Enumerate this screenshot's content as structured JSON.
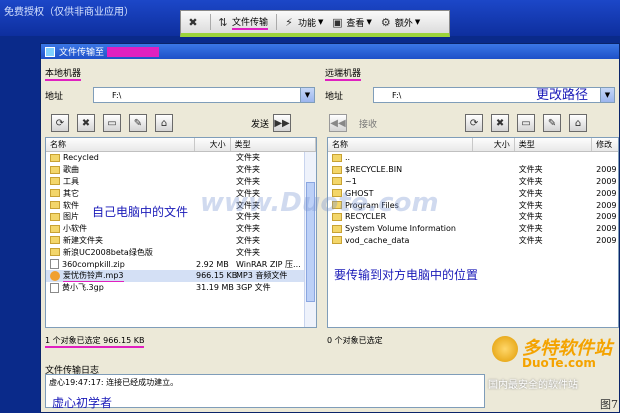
{
  "topbar": {
    "title": "免费授权（仅供非商业应用）"
  },
  "toolbar": {
    "items": [
      {
        "label": ""
      },
      {
        "label": "文件传输"
      },
      {
        "label": "功能"
      },
      {
        "label": "查看"
      },
      {
        "label": "额外"
      }
    ]
  },
  "window": {
    "title": "文件传输至",
    "local": {
      "label": "本地机器",
      "address_label": "地址",
      "address_value": "F:\\",
      "send_label": "发送",
      "columns": [
        "名称",
        "大小",
        "类型"
      ],
      "rows": [
        {
          "name": "Recycled",
          "size": "",
          "type": "文件夹",
          "kind": "folder"
        },
        {
          "name": "歌曲",
          "size": "",
          "type": "文件夹",
          "kind": "folder"
        },
        {
          "name": "工具",
          "size": "",
          "type": "文件夹",
          "kind": "folder"
        },
        {
          "name": "其它",
          "size": "",
          "type": "文件夹",
          "kind": "folder"
        },
        {
          "name": "软件",
          "size": "",
          "type": "文件夹",
          "kind": "folder"
        },
        {
          "name": "图片",
          "size": "",
          "type": "文件夹",
          "kind": "folder"
        },
        {
          "name": "小软件",
          "size": "",
          "type": "文件夹",
          "kind": "folder"
        },
        {
          "name": "新建文件夹",
          "size": "",
          "type": "文件夹",
          "kind": "folder"
        },
        {
          "name": "新浪UC2008beta绿色版",
          "size": "",
          "type": "文件夹",
          "kind": "folder"
        },
        {
          "name": "360compkill.zip",
          "size": "2.92 MB",
          "type": "WinRAR ZIP 压...",
          "kind": "file"
        },
        {
          "name": "爱忧伤铃声.mp3",
          "size": "966.15 KB",
          "type": "MP3 音频文件",
          "kind": "mp3",
          "selected": true
        },
        {
          "name": "黄小飞.3gp",
          "size": "31.19 MB",
          "type": "3GP 文件",
          "kind": "file"
        }
      ],
      "status": "1 个对象已选定    966.15 KB"
    },
    "remote": {
      "label": "远端机器",
      "address_label": "地址",
      "address_value": "F:\\",
      "receive_label": "接收",
      "columns": [
        "名称",
        "大小",
        "类型",
        "修改"
      ],
      "rows": [
        {
          "name": "..",
          "size": "",
          "type": "",
          "date": ""
        },
        {
          "name": "$RECYCLE.BIN",
          "size": "",
          "type": "文件夹",
          "date": "2009"
        },
        {
          "name": "~1",
          "size": "",
          "type": "文件夹",
          "date": "2009"
        },
        {
          "name": "GHOST",
          "size": "",
          "type": "文件夹",
          "date": "2009"
        },
        {
          "name": "Program Files",
          "size": "",
          "type": "文件夹",
          "date": "2009"
        },
        {
          "name": "RECYCLER",
          "size": "",
          "type": "文件夹",
          "date": "2009"
        },
        {
          "name": "System Volume Information",
          "size": "",
          "type": "文件夹",
          "date": "2009"
        },
        {
          "name": "vod_cache_data",
          "size": "",
          "type": "文件夹",
          "date": "2009"
        }
      ],
      "status": "0 个对象已选定"
    },
    "log": {
      "title": "文件传输日志",
      "entries": [
        "虚心19:47:17:  连接已经成功建立。"
      ]
    }
  },
  "annotations": {
    "local_files": "自己电脑中的文件",
    "change_path": "更改路径",
    "target_location": "要传输到对方电脑中的位置",
    "author": "虚心初学者"
  },
  "watermark": {
    "text": "www.Duote.com"
  },
  "logo": {
    "brand": "多特软件站",
    "site": "DuoTe.com",
    "slogan": "国内最安全的软件站"
  },
  "figure_label": "图7"
}
